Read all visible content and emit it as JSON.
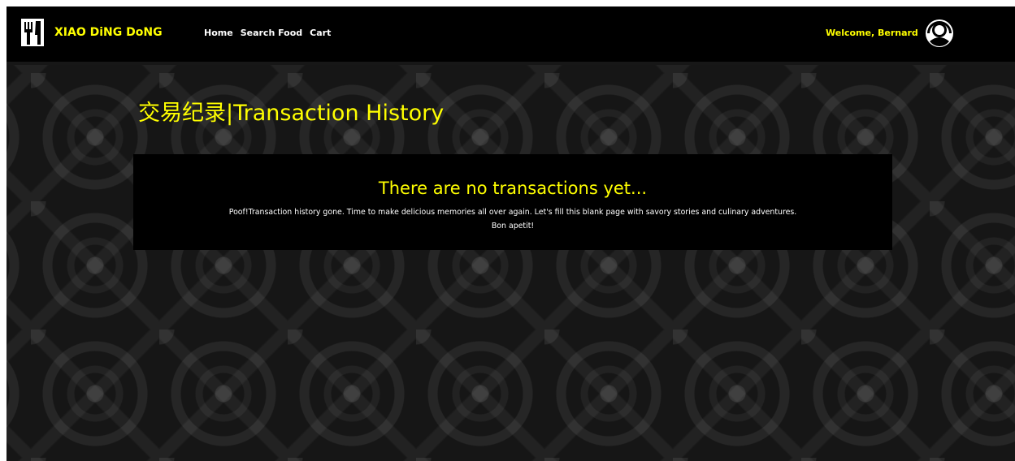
{
  "navbar": {
    "brand_name": "XIAO DiNG DoNG",
    "links": [
      "Home",
      "Search Food",
      "Cart"
    ],
    "welcome_text": "Welcome, Bernard",
    "brand_icon": "fork-knife-icon",
    "avatar_icon": "user-avatar-icon"
  },
  "main": {
    "page_title": "交易纪录|Transaction History",
    "empty_state": {
      "heading": "There are no transactions yet...",
      "message_line1": "Poof!Transaction history gone. Time to make delicious memories all over again. Let's fill this blank page with savory stories and culinary adventures.",
      "message_line2": "Bon apetit!"
    }
  },
  "colors": {
    "accent": "#ffff00",
    "navbar_bg": "#000000",
    "card_bg": "#000000",
    "text": "#ffffff"
  }
}
